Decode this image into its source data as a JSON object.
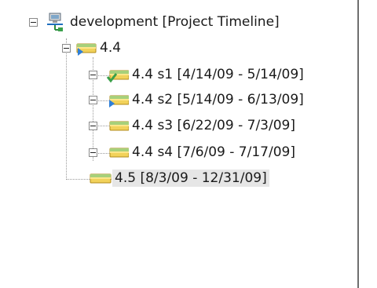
{
  "tree": {
    "root": {
      "label": "development [Project Timeline]",
      "state": "expanded",
      "icon": "project-icon"
    },
    "items": [
      {
        "label": "4.4",
        "state": "expanded",
        "icon": "version-icon"
      },
      {
        "label": "4.4 s1 [4/14/09 - 5/14/09]",
        "state": "collapsed",
        "icon": "sprint-complete-icon"
      },
      {
        "label": "4.4 s2 [5/14/09 - 6/13/09]",
        "state": "collapsed",
        "icon": "sprint-active-icon"
      },
      {
        "label": "4.4 s3 [6/22/09 - 7/3/09]",
        "state": "collapsed",
        "icon": "sprint-icon"
      },
      {
        "label": "4.4 s4 [7/6/09 - 7/17/09]",
        "state": "collapsed",
        "icon": "sprint-icon"
      },
      {
        "label": "4.5 [8/3/09 - 12/31/09]",
        "state": "leaf",
        "icon": "version-icon",
        "selected": true
      }
    ]
  },
  "colors": {
    "folder_green": "#a7d07a",
    "folder_yellow": "#f2d25b",
    "check_green": "#3aa04a",
    "play_blue": "#2f7fd8",
    "selection": "#e6e6e6"
  }
}
